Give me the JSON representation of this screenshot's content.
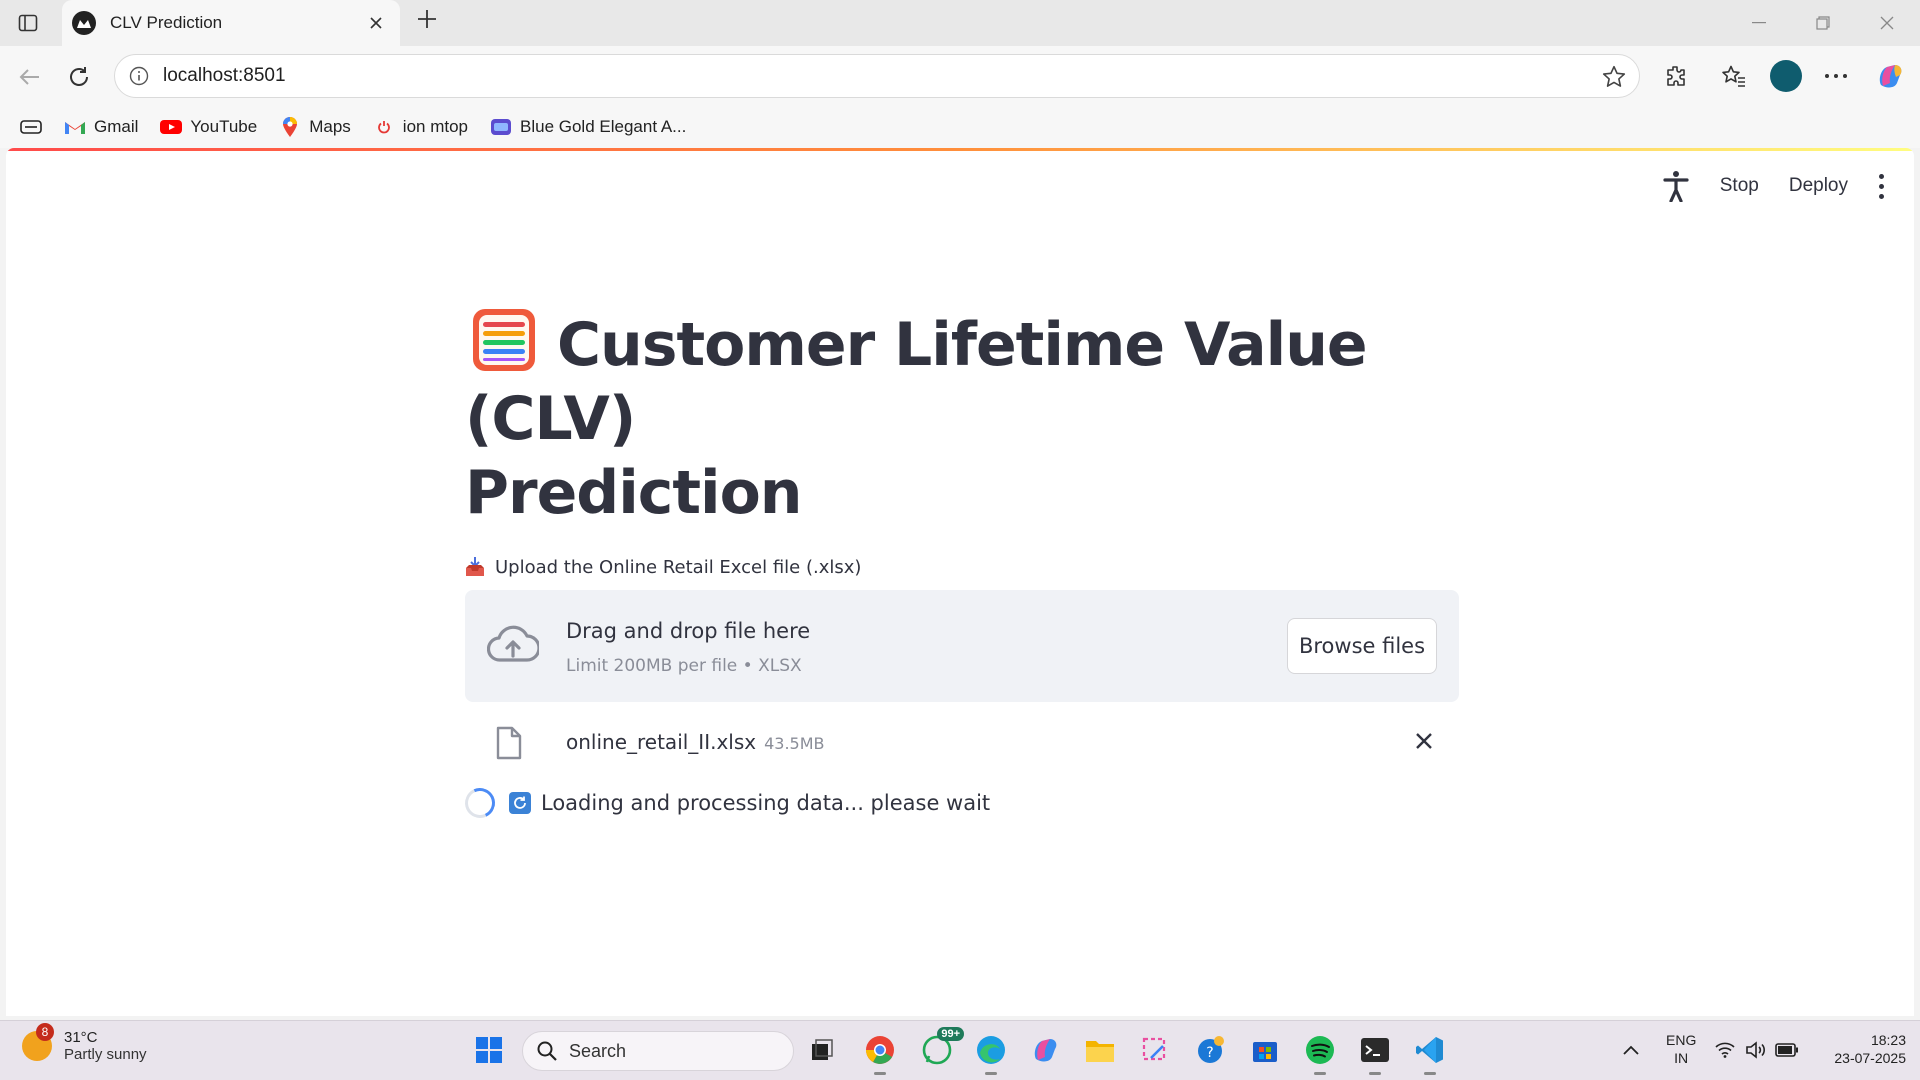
{
  "browser": {
    "tab_title": "CLV Prediction",
    "address": "localhost:8501",
    "bookmarks": [
      {
        "label": "Gmail"
      },
      {
        "label": "YouTube"
      },
      {
        "label": "Maps"
      },
      {
        "label": "ion mtop"
      },
      {
        "label": "Blue Gold Elegant A..."
      }
    ]
  },
  "app": {
    "toolbar": {
      "stop_label": "Stop",
      "deploy_label": "Deploy"
    },
    "title_line1": "Customer Lifetime Value (CLV)",
    "title_line2": "Prediction",
    "upload_label": "Upload the Online Retail Excel file (.xlsx)",
    "dropzone": {
      "title": "Drag and drop file here",
      "subtitle": "Limit 200MB per file • XLSX",
      "browse_label": "Browse files"
    },
    "file": {
      "name": "online_retail_II.xlsx",
      "size": "43.5MB"
    },
    "status_text": "Loading and processing data... please wait"
  },
  "taskbar": {
    "weather_badge": "8",
    "weather_temp": "31°C",
    "weather_cond": "Partly sunny",
    "search_placeholder": "Search",
    "whatsapp_badge": "99+",
    "lang_line1": "ENG",
    "lang_line2": "IN",
    "time": "18:23",
    "date": "23-07-2025"
  },
  "colors": {
    "streamlit_text": "#31333f",
    "dropzone_bg": "#f0f2f6",
    "spinner": "#4c8bf5"
  }
}
